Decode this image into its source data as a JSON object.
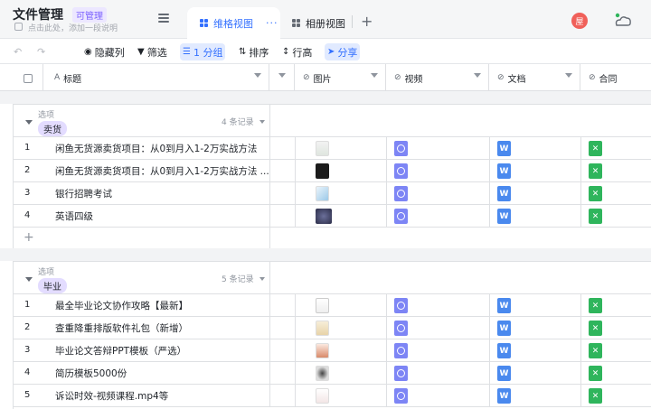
{
  "header": {
    "title": "文件管理",
    "badge": "可管理",
    "description": "点击此处，添加一段说明",
    "tabs": [
      {
        "label": "维格视图",
        "more": "···"
      },
      {
        "label": "相册视图"
      }
    ],
    "add_tab": "+",
    "avatar_text": "屋"
  },
  "toolbar": {
    "undo": "↶",
    "redo": "↷",
    "hide_columns": "隐藏列",
    "filter": "筛选",
    "group": "1 分组",
    "sort": "排序",
    "row_height": "行高",
    "share": "分享"
  },
  "columns": [
    {
      "label": "标题",
      "icon": "A"
    },
    {
      "label": "图片",
      "icon": "⊘"
    },
    {
      "label": "视频",
      "icon": "⊘"
    },
    {
      "label": "文档",
      "icon": "⊘"
    },
    {
      "label": "合同",
      "icon": "⊘"
    }
  ],
  "groups": [
    {
      "label": "选项",
      "tag": "卖货",
      "count": "4 条记录",
      "rows": [
        {
          "num": "1",
          "title": "闲鱼无货源卖货项目：从0到月入1-2万实战方法"
        },
        {
          "num": "2",
          "title": "闲鱼无货源卖货项目：从0到月入1-2万实战方法 ..."
        },
        {
          "num": "3",
          "title": "银行招聘考试"
        },
        {
          "num": "4",
          "title": "英语四级"
        }
      ],
      "add": "+"
    },
    {
      "label": "选项",
      "tag": "毕业",
      "count": "5 条记录",
      "rows": [
        {
          "num": "1",
          "title": "最全毕业论文协作攻略【最新】"
        },
        {
          "num": "2",
          "title": "查重降重排版软件礼包（新增）"
        },
        {
          "num": "3",
          "title": "毕业论文答辩PPT模板（严选）"
        },
        {
          "num": "4",
          "title": "简历模板5000份"
        },
        {
          "num": "5",
          "title": "诉讼时效-视频课程.mp4等"
        }
      ]
    }
  ],
  "file_icons": {
    "doc": "W",
    "xls": "✕"
  },
  "colors": {
    "accent": "#3370ff",
    "badge": "#7b61ff",
    "video": "#7d85f5",
    "doc": "#4a89ee",
    "xls": "#2fb55c",
    "avatar": "#f0605a"
  }
}
